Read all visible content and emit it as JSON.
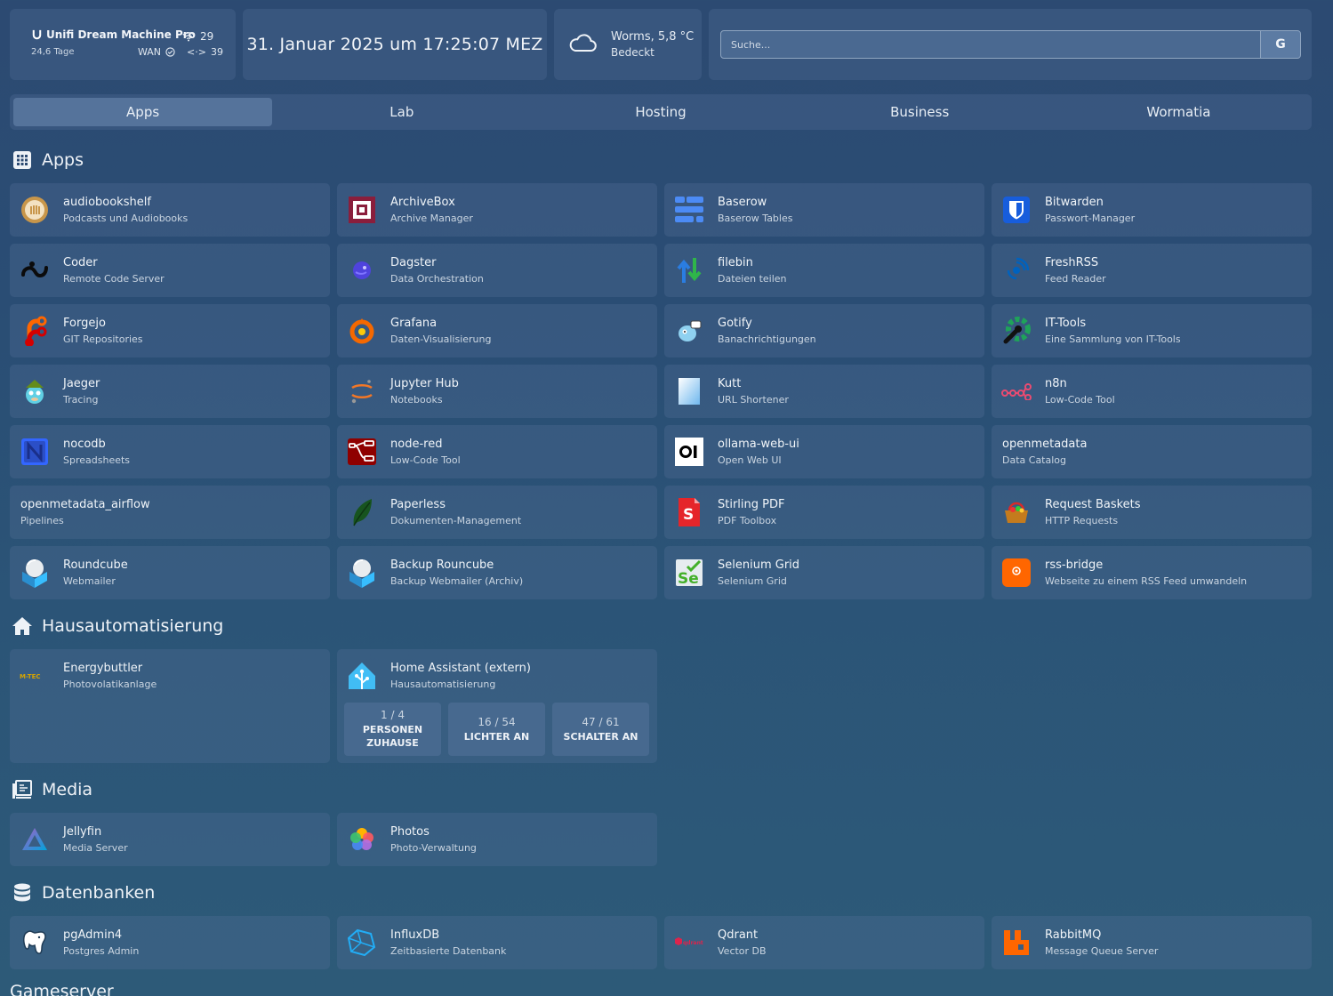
{
  "top": {
    "unifi": {
      "name": "Unifi Dream Machine Pro",
      "uptime": "24,6 Tage",
      "wifi_clients": "29",
      "wan_label": "WAN",
      "wired_clients": "39"
    },
    "datetime": "31. Januar 2025 um 17:25:07 MEZ",
    "weather": {
      "location_temp": "Worms, 5,8 °C",
      "condition": "Bedeckt",
      "icon": "cloud-icon"
    },
    "search": {
      "placeholder": "Suche...",
      "button": "G"
    }
  },
  "tabs": [
    "Apps",
    "Lab",
    "Hosting",
    "Business",
    "Wormatia"
  ],
  "sections": {
    "apps": "Apps",
    "home": "Hausautomatisierung",
    "media": "Media",
    "db": "Datenbanken",
    "games": "Gameserver"
  },
  "apps": [
    {
      "name": "audiobookshelf",
      "desc": "Podcasts und Audiobooks",
      "icon": "audiobookshelf-icon"
    },
    {
      "name": "ArchiveBox",
      "desc": "Archive Manager",
      "icon": "archivebox-icon"
    },
    {
      "name": "Baserow",
      "desc": "Baserow Tables",
      "icon": "baserow-icon"
    },
    {
      "name": "Bitwarden",
      "desc": "Passwort-Manager",
      "icon": "bitwarden-icon"
    },
    {
      "name": "Coder",
      "desc": "Remote Code Server",
      "icon": "coder-icon"
    },
    {
      "name": "Dagster",
      "desc": "Data Orchestration",
      "icon": "dagster-icon"
    },
    {
      "name": "filebin",
      "desc": "Dateien teilen",
      "icon": "filebin-icon"
    },
    {
      "name": "FreshRSS",
      "desc": "Feed Reader",
      "icon": "freshrss-icon"
    },
    {
      "name": "Forgejo",
      "desc": "GIT Repositories",
      "icon": "forgejo-icon"
    },
    {
      "name": "Grafana",
      "desc": "Daten-Visualisierung",
      "icon": "grafana-icon"
    },
    {
      "name": "Gotify",
      "desc": "Banachrichtigungen",
      "icon": "gotify-icon"
    },
    {
      "name": "IT-Tools",
      "desc": "Eine Sammlung von IT-Tools",
      "icon": "it-tools-icon"
    },
    {
      "name": "Jaeger",
      "desc": "Tracing",
      "icon": "jaeger-icon"
    },
    {
      "name": "Jupyter Hub",
      "desc": "Notebooks",
      "icon": "jupyter-icon"
    },
    {
      "name": "Kutt",
      "desc": "URL Shortener",
      "icon": "kutt-icon"
    },
    {
      "name": "n8n",
      "desc": "Low-Code Tool",
      "icon": "n8n-icon"
    },
    {
      "name": "nocodb",
      "desc": "Spreadsheets",
      "icon": "nocodb-icon"
    },
    {
      "name": "node-red",
      "desc": "Low-Code Tool",
      "icon": "node-red-icon"
    },
    {
      "name": "ollama-web-ui",
      "desc": "Open Web UI",
      "icon": "openwebui-icon"
    },
    {
      "name": "openmetadata",
      "desc": "Data Catalog",
      "icon": ""
    },
    {
      "name": "openmetadata_airflow",
      "desc": "Pipelines",
      "icon": ""
    },
    {
      "name": "Paperless",
      "desc": "Dokumenten-Management",
      "icon": "paperless-icon"
    },
    {
      "name": "Stirling PDF",
      "desc": "PDF Toolbox",
      "icon": "stirling-pdf-icon"
    },
    {
      "name": "Request Baskets",
      "desc": "HTTP Requests",
      "icon": "request-baskets-icon"
    },
    {
      "name": "Roundcube",
      "desc": "Webmailer",
      "icon": "roundcube-icon"
    },
    {
      "name": "Backup Rouncube",
      "desc": "Backup Webmailer (Archiv)",
      "icon": "roundcube-icon"
    },
    {
      "name": "Selenium Grid",
      "desc": "Selenium Grid",
      "icon": "selenium-icon"
    },
    {
      "name": "rss-bridge",
      "desc": "Webseite zu einem RSS Feed umwandeln",
      "icon": "rss-bridge-icon"
    }
  ],
  "home": {
    "energy": {
      "name": "Energybuttler",
      "desc": "Photovolatikanlage",
      "logo_text": "M-TEC"
    },
    "ha": {
      "name": "Home Assistant (extern)",
      "desc": "Hausautomatisierung",
      "stats": [
        {
          "value": "1 / 4",
          "label": "PERSONEN ZUHAUSE"
        },
        {
          "value": "16 / 54",
          "label": "LICHTER AN"
        },
        {
          "value": "47 / 61",
          "label": "SCHALTER AN"
        }
      ]
    }
  },
  "media": [
    {
      "name": "Jellyfin",
      "desc": "Media Server"
    },
    {
      "name": "Photos",
      "desc": "Photo-Verwaltung"
    }
  ],
  "db": [
    {
      "name": "pgAdmin4",
      "desc": "Postgres Admin"
    },
    {
      "name": "InfluxDB",
      "desc": "Zeitbasierte Datenbank"
    },
    {
      "name": "Qdrant",
      "desc": "Vector DB",
      "logo_text": "qdrant"
    },
    {
      "name": "RabbitMQ",
      "desc": "Message Queue Server"
    }
  ],
  "colors": {
    "background": "#2b4e74",
    "tile": "#4a6a92",
    "accent": "#f2f5f9"
  }
}
